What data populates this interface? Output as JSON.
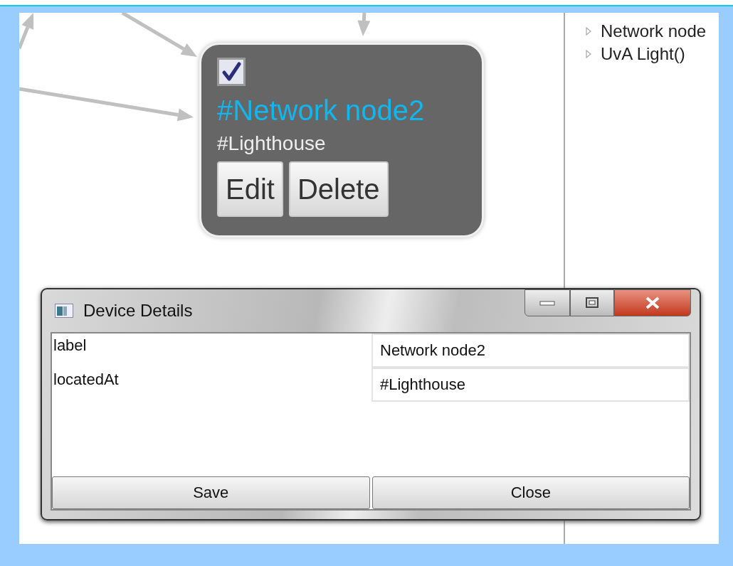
{
  "node": {
    "checked": true,
    "title": "#Network node2",
    "subtitle": "#Lighthouse",
    "buttons": [
      "Edit",
      "Delete"
    ]
  },
  "tree": {
    "items": [
      {
        "label": "Network node",
        "expanded": false
      },
      {
        "label": "UvA Light()",
        "expanded": false
      }
    ]
  },
  "dialog": {
    "title": "Device Details",
    "fields": [
      {
        "label": "label",
        "value": "Network node2"
      },
      {
        "label": "locatedAt",
        "value": "#Lighthouse"
      }
    ],
    "buttons": [
      "Save",
      "Close"
    ]
  }
}
